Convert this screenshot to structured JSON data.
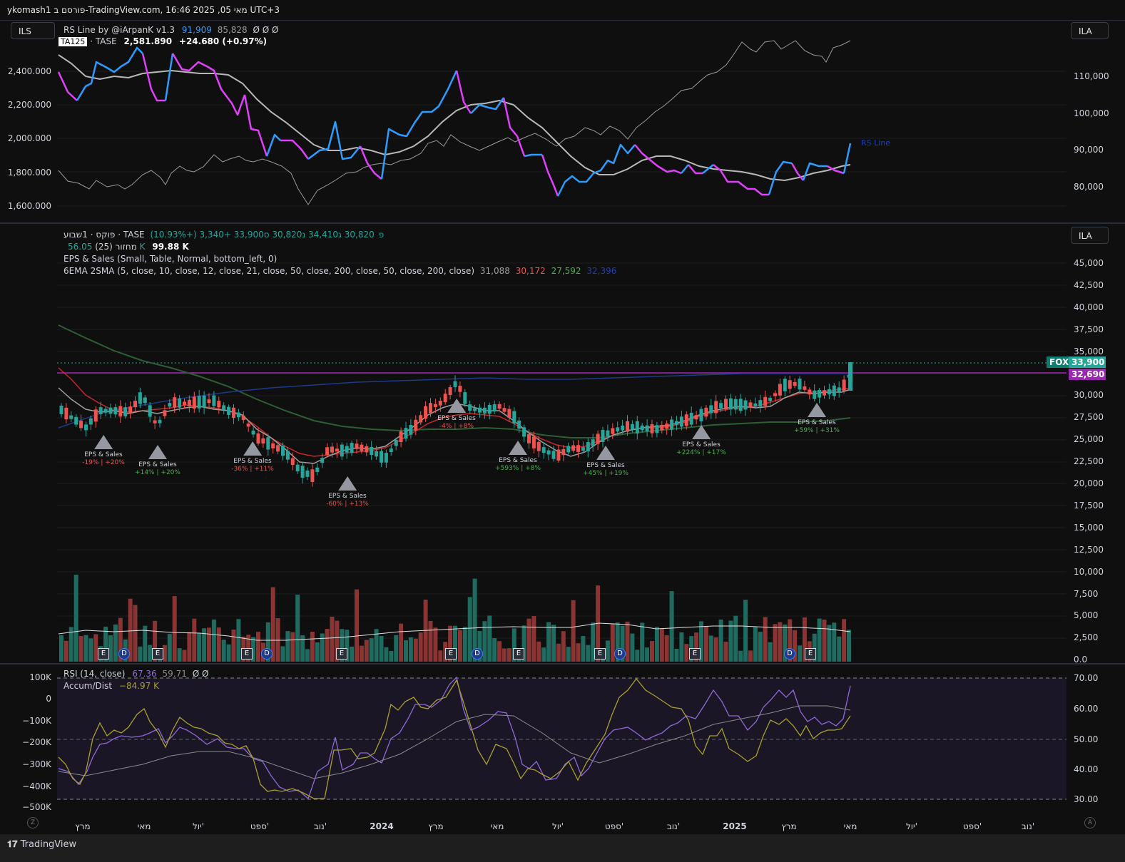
{
  "window": {
    "title": "ykomash1 פורסם ב-TradingView.com, 16:46 2025 ,05 מאי UTC+3"
  },
  "colors": {
    "up": "#26a69a",
    "down": "#ef5350",
    "rs_up": "#2d9cff",
    "rs_down": "#e040fb",
    "purple_line": "#9c27b0",
    "bg": "#0f0f0f"
  },
  "pane1": {
    "currency_box": "ILS",
    "scale_box": "ILA",
    "legend": {
      "indicator": "RS Line by @iArpanK v1.3",
      "v1": "91,909",
      "v2": "85,828",
      "nulls": "Ø Ø Ø",
      "symbol_tag": "TA125",
      "symbol_rest": "· TASE",
      "price": "2,581.890",
      "change": "+24.680 (+0.97%)"
    },
    "left_axis": [
      "2,400.000",
      "2,200.000",
      "2,000.000",
      "1,800.000",
      "1,600.000"
    ],
    "right_axis": [
      "110,000",
      "100,000",
      "90,000",
      "80,000"
    ],
    "rs_label": "RS Line"
  },
  "pane2": {
    "scale_box": "ILA",
    "legend": {
      "title": "פוקס · 1שבוע · TASE",
      "o_lbl": "פ",
      "o": "30,820",
      "h_lbl": "ג",
      "h": "34,410",
      "l_lbl": "נ",
      "l": "30,820",
      "c_lbl": "ס",
      "c": "33,900",
      "chg": "+3,340 (+10.93%)",
      "vol_lbl": "מחזור (25)",
      "vol1": "56.05 K",
      "vol2": "99.88 K",
      "eps": "EPS & Sales (Small, Table, Normal, bottom_left, 0)",
      "ma": "6EMA 2SMA (5, close, 10, close, 12, close, 21, close, 50, close, 200, close, 50, close, 200, close)",
      "ma1": "31,088",
      "ma2": "30,172",
      "ma3": "27,592",
      "ma4": "32,396"
    },
    "right_axis": [
      "45,000",
      "42,500",
      "40,000",
      "37,500",
      "35,000",
      "32,500",
      "30,000",
      "27,500",
      "25,000",
      "22,500",
      "20,000",
      "17,500",
      "15,000",
      "12,500",
      "10,000",
      "7,500",
      "5,000",
      "2,500",
      "0.0"
    ],
    "price_tags": {
      "ticker": "FOX",
      "last": "33,900",
      "line": "32,690"
    },
    "eps_labels": [
      {
        "title": "EPS & Sales",
        "eps": "-19%",
        "sales": "+20%",
        "eps_c": "#ef5350",
        "sales_c": "#ef5350"
      },
      {
        "title": "EPS & Sales",
        "eps": "+14%",
        "sales": "+20%",
        "eps_c": "#4caf50",
        "sales_c": "#4caf50"
      },
      {
        "title": "EPS & Sales",
        "eps": "-36%",
        "sales": "+11%",
        "eps_c": "#ef5350",
        "sales_c": "#ef5350"
      },
      {
        "title": "EPS & Sales",
        "eps": "-60%",
        "sales": "+13%",
        "eps_c": "#ef5350",
        "sales_c": "#ef5350"
      },
      {
        "title": "EPS & Sales",
        "eps": "-4%",
        "sales": "+8%",
        "eps_c": "#ef5350",
        "sales_c": "#ef5350"
      },
      {
        "title": "EPS & Sales",
        "eps": "+593%",
        "sales": "+8%",
        "eps_c": "#4caf50",
        "sales_c": "#4caf50"
      },
      {
        "title": "EPS & Sales",
        "eps": "+45%",
        "sales": "+19%",
        "eps_c": "#4caf50",
        "sales_c": "#4caf50"
      },
      {
        "title": "EPS & Sales",
        "eps": "+224%",
        "sales": "+17%",
        "eps_c": "#4caf50",
        "sales_c": "#4caf50"
      },
      {
        "title": "EPS & Sales",
        "eps": "+59%",
        "sales": "+31%",
        "eps_c": "#4caf50",
        "sales_c": "#4caf50"
      }
    ],
    "markers": [
      "E",
      "D",
      "E",
      "E",
      "D",
      "E",
      "E",
      "D",
      "E",
      "E",
      "D",
      "E",
      "D",
      "E"
    ]
  },
  "pane3": {
    "legend": {
      "rsi": "RSI (14, close)",
      "rsi_v1": "67.36",
      "rsi_v2": "59.71",
      "nulls": "Ø Ø",
      "ad": "Accum/Dist",
      "ad_v": "−84.97 K"
    },
    "left_axis": [
      "100K",
      "0",
      "−100K",
      "−200K",
      "−300K",
      "−400K",
      "−500K"
    ],
    "right_axis": [
      "70.00",
      "60.00",
      "50.00",
      "40.00",
      "30.00"
    ]
  },
  "xaxis": [
    "מרץ",
    "מאי",
    "יול'",
    "ספט'",
    "נוב'",
    "2024",
    "מרץ",
    "מאי",
    "יול'",
    "ספט'",
    "נוב'",
    "2025",
    "מרץ",
    "מאי",
    "יול'",
    "ספט'",
    "נוב'"
  ],
  "footer": {
    "brand": "TradingView",
    "left_btn": "Z",
    "right_btn": "A"
  }
}
